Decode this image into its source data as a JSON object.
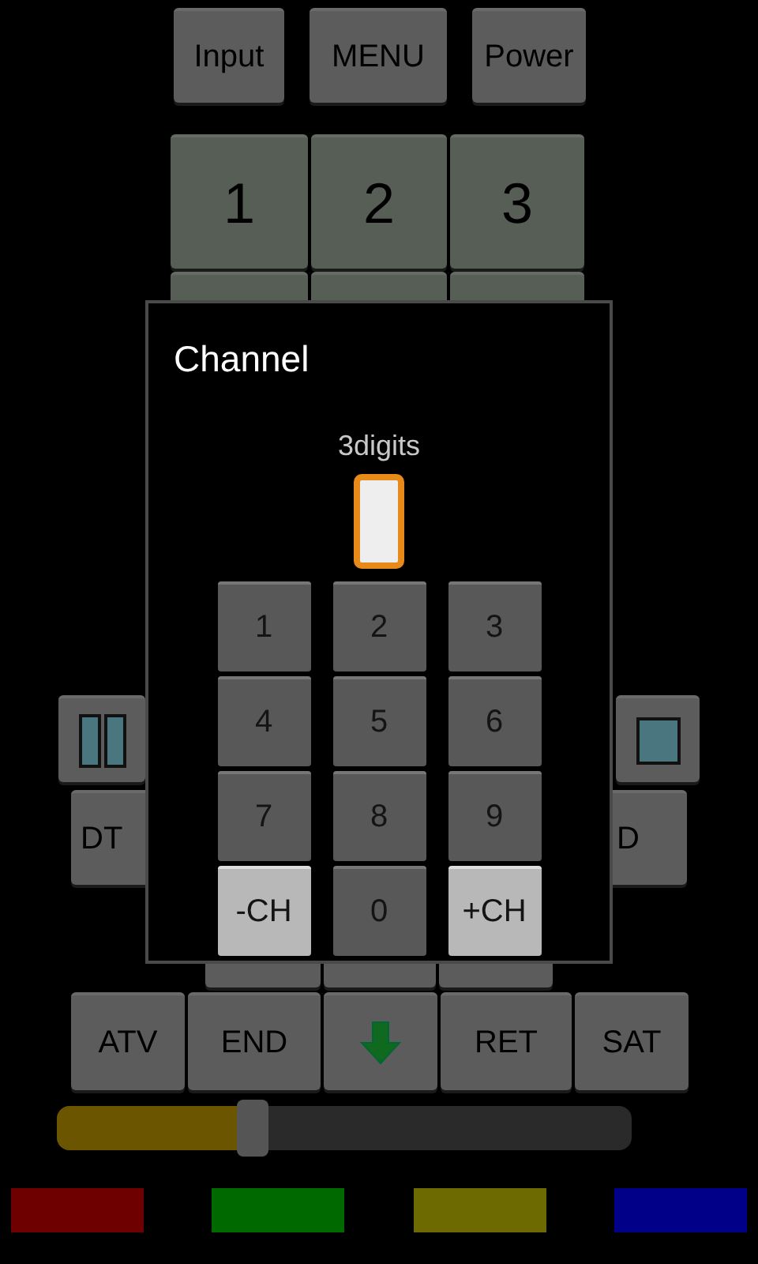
{
  "remote": {
    "top_buttons": [
      {
        "label": "Input"
      },
      {
        "label": "MENU"
      },
      {
        "label": "Power"
      }
    ],
    "number_keys": [
      {
        "label": "1"
      },
      {
        "label": "2"
      },
      {
        "label": "3"
      }
    ],
    "mode_buttons": [
      {
        "label": "DT"
      },
      {
        "label": "D"
      }
    ],
    "bottom_buttons": [
      {
        "kind": "text",
        "label": "ATV"
      },
      {
        "kind": "text",
        "label": "END"
      },
      {
        "kind": "arrow"
      },
      {
        "kind": "text",
        "label": "RET"
      },
      {
        "kind": "text",
        "label": "SAT"
      }
    ],
    "slider": {
      "level": 0.34
    },
    "color_buttons": [
      {
        "color": "#6e0000"
      },
      {
        "color": "#006a00"
      },
      {
        "color": "#6c6a00"
      },
      {
        "color": "#000088"
      }
    ]
  },
  "dialog": {
    "title": "Channel",
    "field_label": "3digits",
    "field": {
      "focused": true
    },
    "keys": [
      {
        "kind": "digit",
        "label": "1"
      },
      {
        "kind": "digit",
        "label": "2"
      },
      {
        "kind": "digit",
        "label": "3"
      },
      {
        "kind": "digit",
        "label": "4"
      },
      {
        "kind": "digit",
        "label": "5"
      },
      {
        "kind": "digit",
        "label": "6"
      },
      {
        "kind": "digit",
        "label": "7"
      },
      {
        "kind": "digit",
        "label": "8"
      },
      {
        "kind": "digit",
        "label": "9"
      },
      {
        "kind": "channel",
        "label": "-CH"
      },
      {
        "kind": "digit",
        "label": "0"
      },
      {
        "kind": "channel",
        "label": "+CH"
      }
    ]
  }
}
